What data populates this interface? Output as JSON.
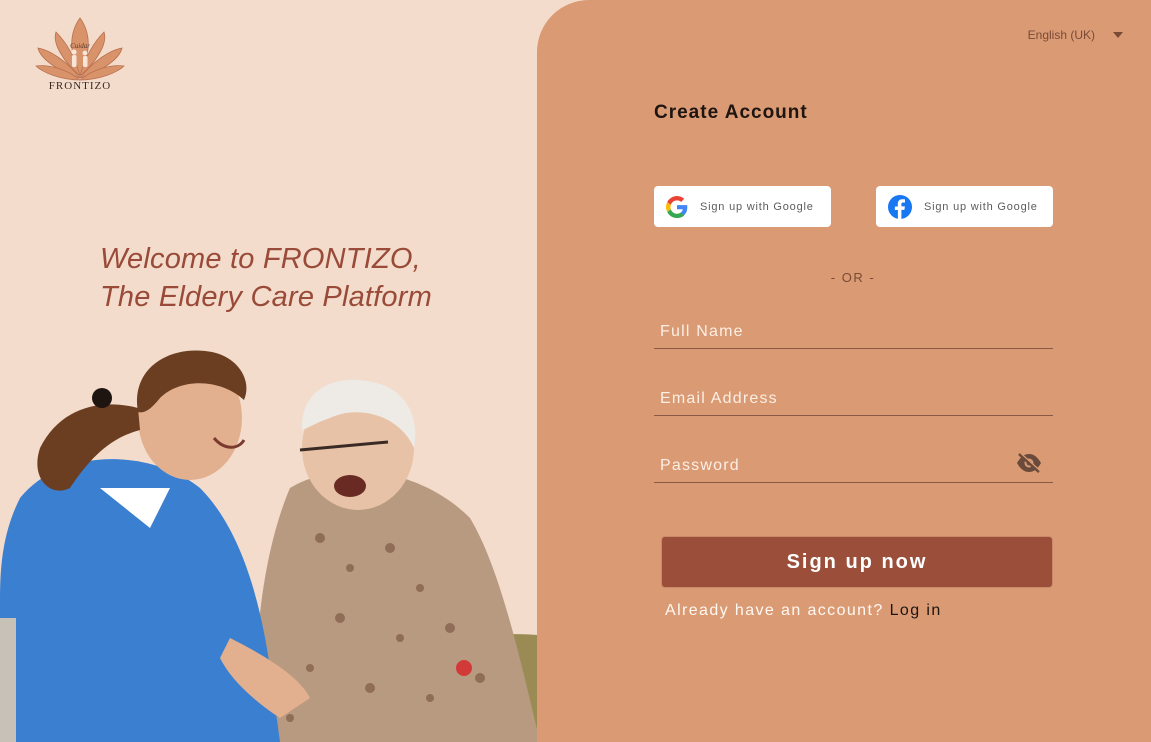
{
  "brand": {
    "logo_name": "FRONTIZO",
    "logo_script": "Cuidar"
  },
  "hero": {
    "line1": "Welcome to FRONTIZO,",
    "line2": "The Eldery Care Platform",
    "photo_icon": "caregiver-photo"
  },
  "language": {
    "selected": "English (UK)",
    "icon": "chevron-down-icon"
  },
  "form": {
    "title": "Create Account",
    "google_label": "Sign up with Google",
    "facebook_label": "Sign up with Google",
    "divider": "- OR -",
    "full_name_placeholder": "Full Name",
    "email_placeholder": "Email Address",
    "password_placeholder": "Password",
    "password_icon": "eye-off-icon",
    "submit_label": "Sign up now",
    "already_text": "Already have an account?",
    "login_link": "Log in"
  },
  "colors": {
    "left_bg": "#f3dccb",
    "right_bg": "#da9b74",
    "accent": "#9b4e3a",
    "heading": "#9a4a38"
  }
}
